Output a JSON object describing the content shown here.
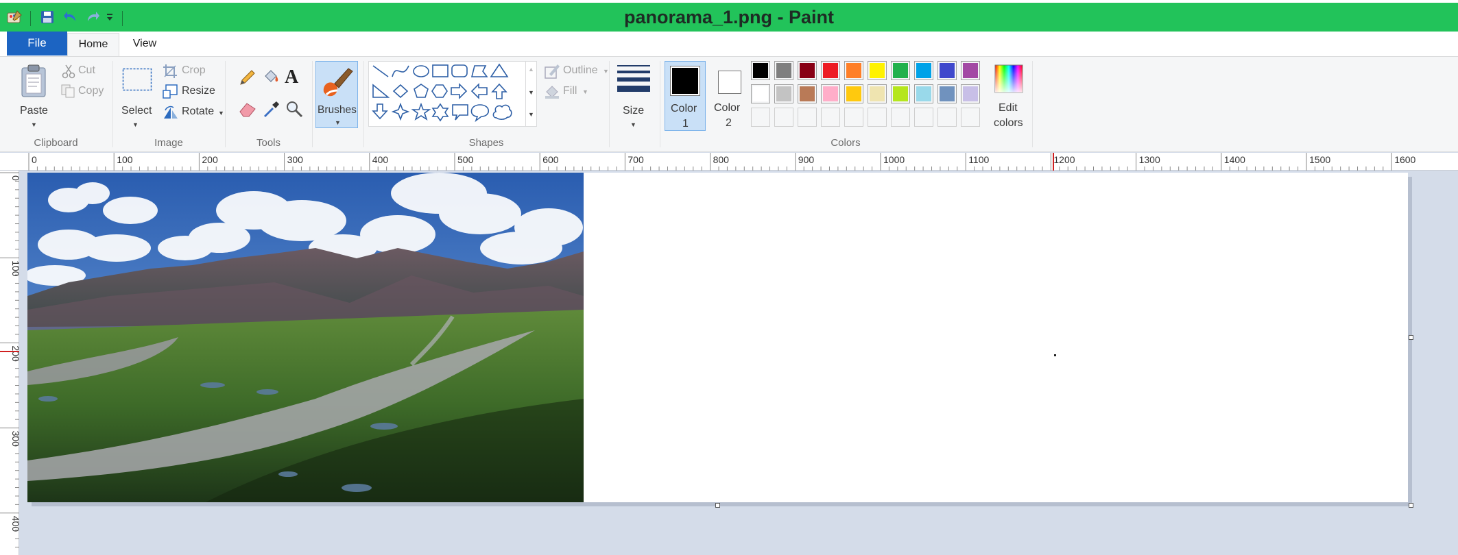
{
  "window": {
    "title": "panorama_1.png - Paint"
  },
  "tabs": {
    "file": "File",
    "home": "Home",
    "view": "View"
  },
  "clipboard": {
    "paste": "Paste",
    "cut": "Cut",
    "copy": "Copy",
    "group_label": "Clipboard"
  },
  "image": {
    "select": "Select",
    "crop": "Crop",
    "resize": "Resize",
    "rotate": "Rotate",
    "group_label": "Image"
  },
  "tools": {
    "group_label": "Tools",
    "text_tool_glyph": "A"
  },
  "brushes": {
    "label": "Brushes"
  },
  "shapes": {
    "outline": "Outline",
    "fill": "Fill",
    "group_label": "Shapes"
  },
  "size": {
    "label": "Size"
  },
  "colors": {
    "color1_label": "Color",
    "color1_num": "1",
    "color2_label": "Color",
    "color2_num": "2",
    "edit_label": "Edit",
    "edit_label2": "colors",
    "group_label": "Colors",
    "color1": "#000000",
    "color2": "#ffffff",
    "palette_row1": [
      "#000000",
      "#7f7f7f",
      "#880015",
      "#ed1c24",
      "#ff7f27",
      "#fff200",
      "#22b14c",
      "#00a2e8",
      "#3f48cc",
      "#a349a4"
    ],
    "palette_row2": [
      "#ffffff",
      "#c3c3c3",
      "#b97a57",
      "#ffaec9",
      "#ffc90e",
      "#efe4b0",
      "#b5e61d",
      "#99d9ea",
      "#7092be",
      "#c8bfe7"
    ]
  },
  "ruler": {
    "h_ticks": [
      "0",
      "100",
      "200",
      "300",
      "400",
      "500",
      "600",
      "700",
      "800",
      "900",
      "1000",
      "1100",
      "1200",
      "1300",
      "1400",
      "1500",
      "1600"
    ],
    "v_ticks": [
      "0",
      "100",
      "200",
      "300",
      "400"
    ]
  },
  "theme": {
    "title_bar": "#22c35a",
    "accent": "#1c64c2",
    "workspace": "#d4dce9"
  }
}
